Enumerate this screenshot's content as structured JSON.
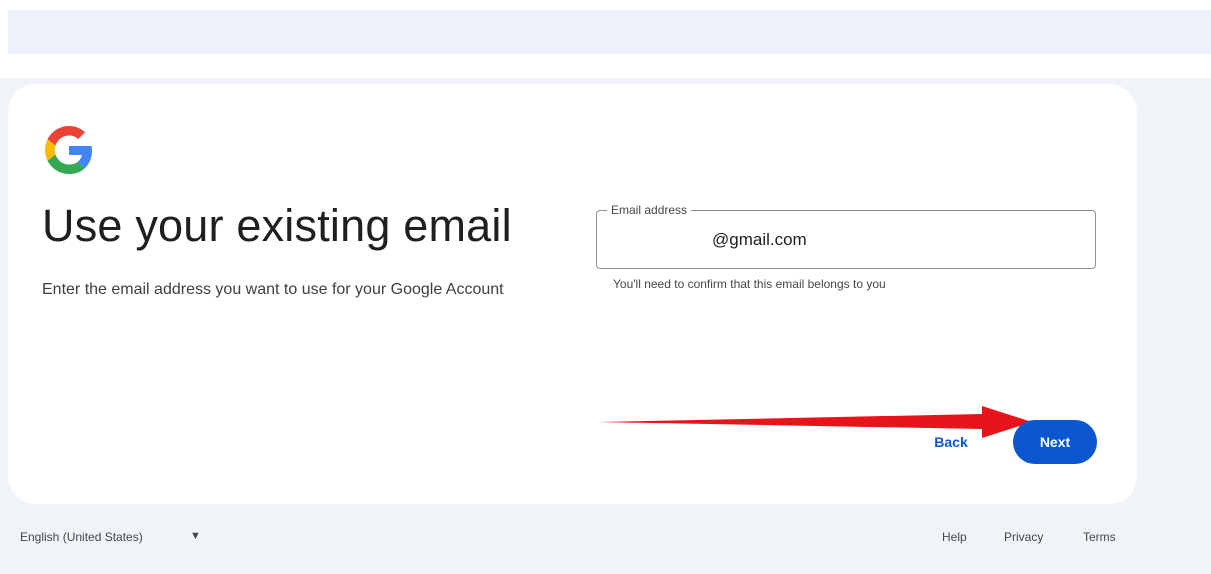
{
  "header": {
    "title": "Use your existing email",
    "subtitle": "Enter the email address you want to use for your Google Account"
  },
  "logo": {
    "icon": "google-g-icon",
    "colors": {
      "blue": "#4285F4",
      "red": "#EA4335",
      "yellow": "#FBBC05",
      "green": "#34A853"
    }
  },
  "email_field": {
    "label": "Email address",
    "value": "@gmail.com",
    "helper": "You'll need to confirm that this email belongs to you"
  },
  "actions": {
    "back_label": "Back",
    "next_label": "Next"
  },
  "annotation": {
    "icon": "red-arrow-icon",
    "color": "#e8141b"
  },
  "footer": {
    "language": "English (United States)",
    "language_caret_icon": "caret-down-icon",
    "links": {
      "help": "Help",
      "privacy": "Privacy",
      "terms": "Terms"
    }
  },
  "theme": {
    "accent": "#0b57d0",
    "page_background": "#f0f4f9",
    "card_background": "#ffffff"
  }
}
